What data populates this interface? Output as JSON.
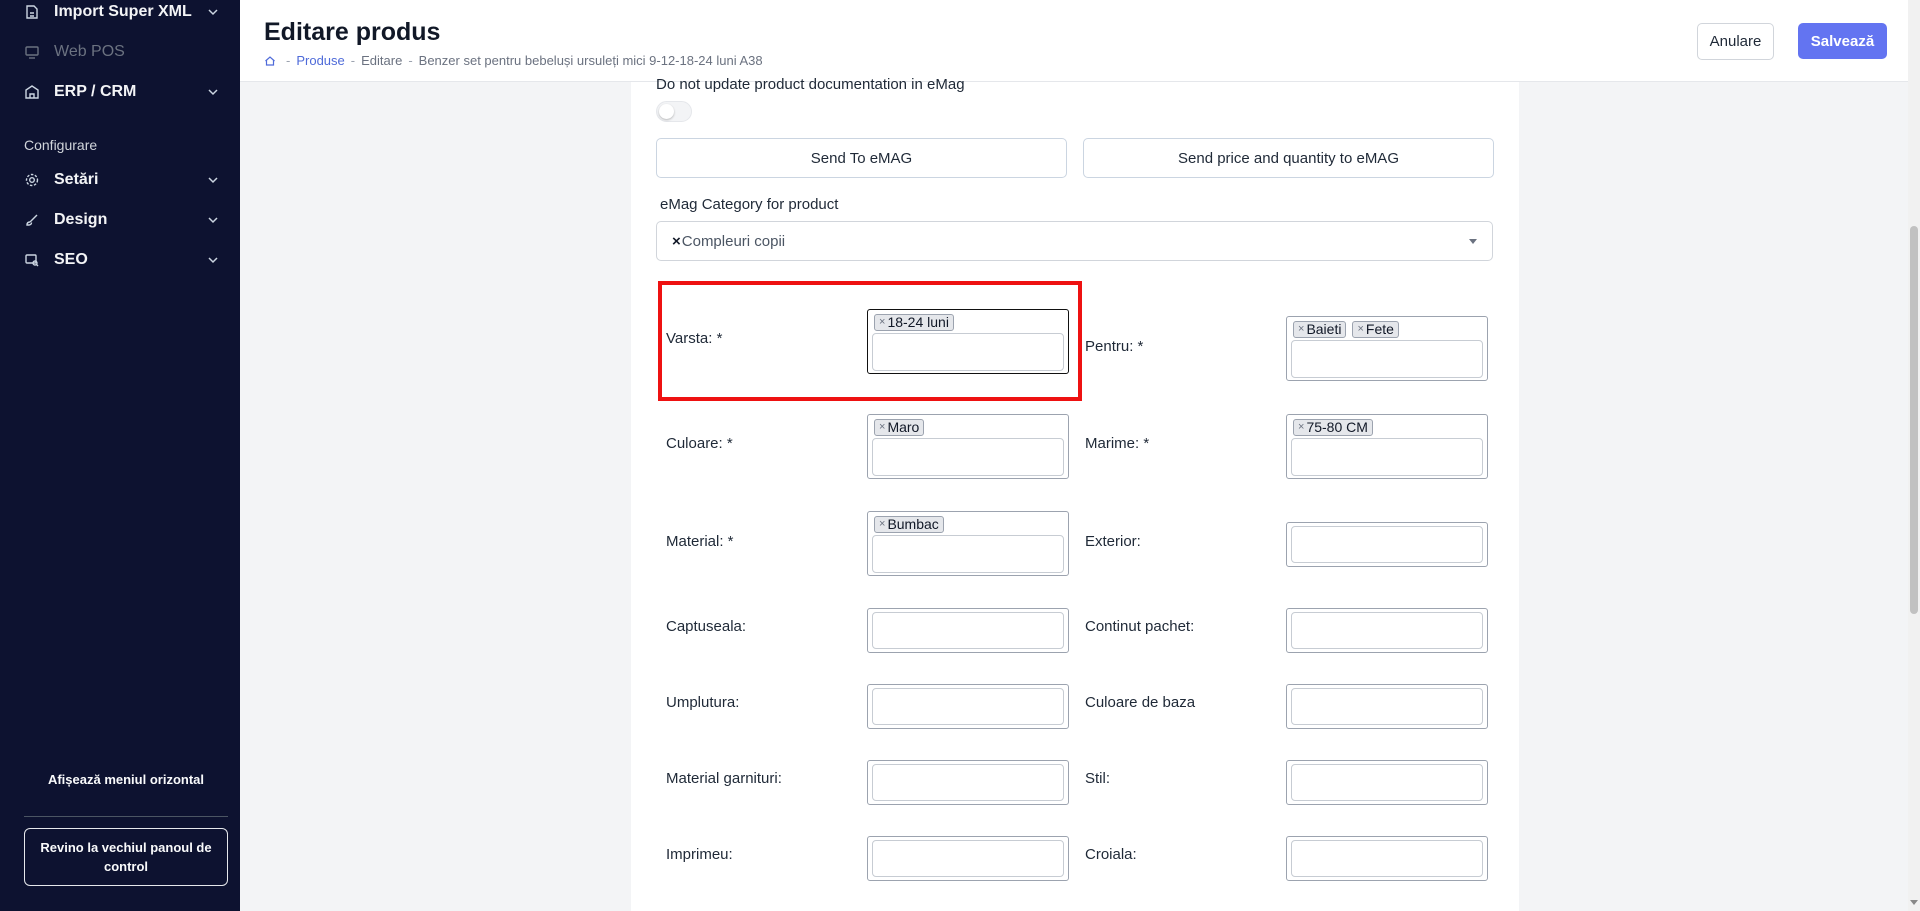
{
  "sidebar": {
    "items": [
      {
        "label": "Import Super XML",
        "icon": "import-icon",
        "expandable": true,
        "disabled": false
      },
      {
        "label": "Web POS",
        "icon": "monitor-icon",
        "expandable": false,
        "disabled": true
      },
      {
        "label": "ERP / CRM",
        "icon": "building-icon",
        "expandable": true,
        "disabled": false
      },
      {
        "label": "Setări",
        "icon": "gear-icon",
        "expandable": true,
        "disabled": false
      },
      {
        "label": "Design",
        "icon": "brush-icon",
        "expandable": true,
        "disabled": false
      },
      {
        "label": "SEO",
        "icon": "search-monitor-icon",
        "expandable": true,
        "disabled": false
      }
    ],
    "section_label": "Configurare",
    "horizontal_menu_label": "Afișează meniul orizontal",
    "old_panel_label": "Revino la vechiul panoul de control"
  },
  "header": {
    "title": "Editare produs",
    "breadcrumb": [
      "Produse",
      "Editare",
      "Benzer set pentru bebeluși ursuleți mici 9-12-18-24 luni A38"
    ],
    "cancel_label": "Anulare",
    "save_label": "Salvează"
  },
  "form": {
    "toggle_label": "Do not update product documentation in eMag",
    "toggle_on": false,
    "send_emag_label": "Send To eMAG",
    "send_price_label": "Send price and quantity to eMAG",
    "category_label": "eMag Category for product",
    "category_remove": "×",
    "category_value": "Compleuri copii",
    "tag_remove": "×",
    "fields": {
      "varsta": {
        "label": "Varsta: *",
        "tags": [
          "18-24 luni"
        ]
      },
      "pentru": {
        "label": "Pentru: *",
        "tags": [
          "Baieti",
          "Fete"
        ]
      },
      "culoare": {
        "label": "Culoare: *",
        "tags": [
          "Maro"
        ]
      },
      "marime": {
        "label": "Marime: *",
        "tags": [
          "75-80 CM"
        ]
      },
      "material": {
        "label": "Material: *",
        "tags": [
          "Bumbac"
        ]
      },
      "exterior": {
        "label": "Exterior:",
        "tags": []
      },
      "captuseala": {
        "label": "Captuseala:",
        "tags": []
      },
      "continut": {
        "label": "Continut pachet:",
        "tags": []
      },
      "umplutura": {
        "label": "Umplutura:",
        "tags": []
      },
      "culoare_baza": {
        "label": "Culoare de baza",
        "tags": []
      },
      "material_garnituri": {
        "label": "Material garnituri:",
        "tags": []
      },
      "stil": {
        "label": "Stil:",
        "tags": []
      },
      "imprimeu": {
        "label": "Imprimeu:",
        "tags": []
      },
      "croiala": {
        "label": "Croiala:",
        "tags": []
      }
    }
  },
  "colors": {
    "sidebar_bg": "#0d1230",
    "primary": "#6374f1",
    "link": "#4f6bd9",
    "highlight": "#ee1111"
  }
}
